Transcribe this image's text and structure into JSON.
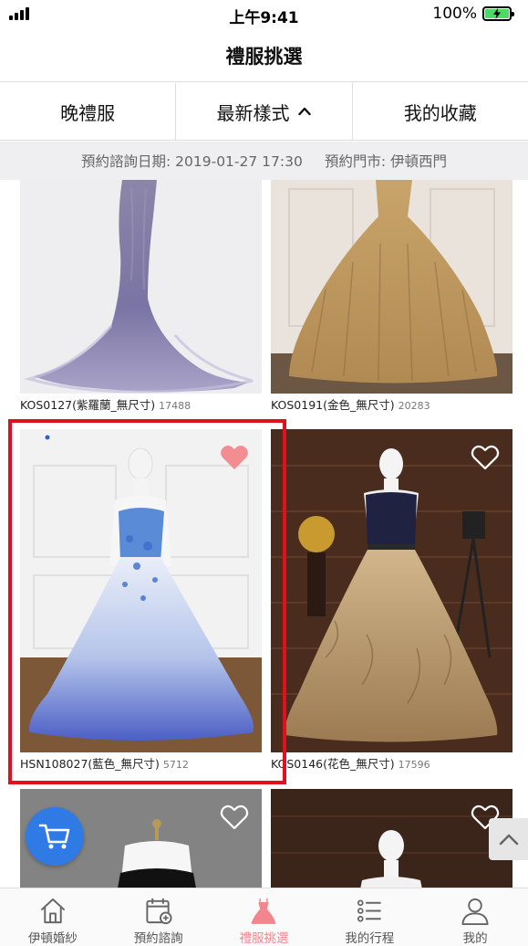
{
  "status_bar": {
    "time": "上午9:41",
    "battery_pct": "100%"
  },
  "header": {
    "title": "禮服挑選"
  },
  "filters": [
    {
      "label": "晚禮服"
    },
    {
      "label": "最新樣式"
    },
    {
      "label": "我的收藏"
    }
  ],
  "info": {
    "date_text": "預約諮詢日期: 2019-01-27 17:30",
    "store_text": "預約門市: 伊頓西門"
  },
  "products": [
    {
      "code": "KOS0127(紫羅蘭_無尺寸)",
      "count": "17488"
    },
    {
      "code": "KOS0191(金色_無尺寸)",
      "count": "20283"
    },
    {
      "code": "HSN108027(藍色_無尺寸)",
      "count": "5712",
      "favorited": true
    },
    {
      "code": "KOS0146(花色_無尺寸)",
      "count": "17596",
      "favorited": false
    }
  ],
  "tabbar": [
    {
      "label": "伊頓婚紗",
      "icon": "home-icon"
    },
    {
      "label": "預約諮詢",
      "icon": "calendar-add-icon"
    },
    {
      "label": "禮服挑選",
      "icon": "dress-icon",
      "active": true
    },
    {
      "label": "我的行程",
      "icon": "list-icon"
    },
    {
      "label": "我的",
      "icon": "user-icon"
    }
  ],
  "colors": {
    "accent_pink": "#f2868c",
    "selection_red": "#e0101f",
    "cart_blue": "#2f7ae5"
  }
}
